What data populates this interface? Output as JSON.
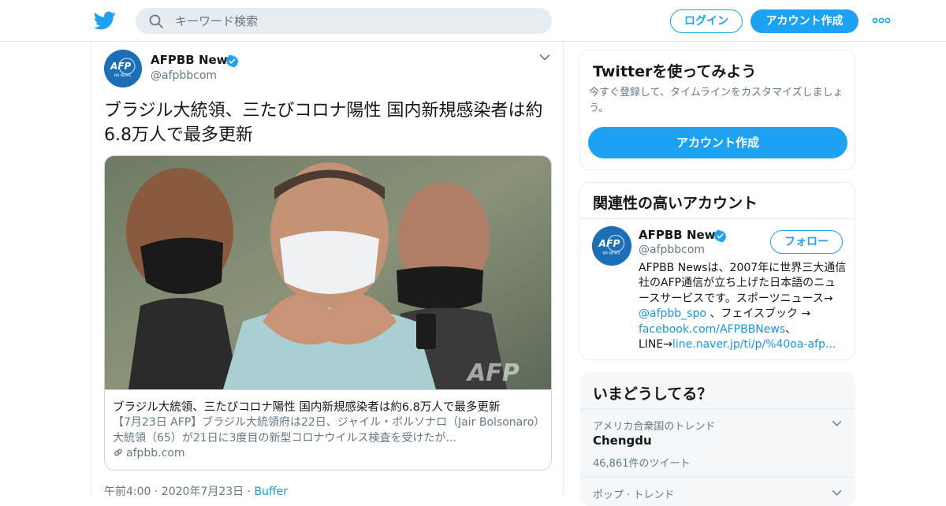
{
  "header": {
    "search_placeholder": "キーワード検索",
    "login_label": "ログイン",
    "signup_label": "アカウント作成"
  },
  "tweet": {
    "user_name": "AFPBB News",
    "user_handle": "@afpbbcom",
    "text": "ブラジル大統領、三たびコロナ陽性 国内新規感染者は約6.8万人で最多更新",
    "card": {
      "title": "ブラジル大統領、三たびコロナ陽性 国内新規感染者は約6.8万人で最多更新",
      "description": "【7月23日 AFP】ブラジル大統領府は22日、ジャイル・ボルソナロ（Jair Bolsonaro）大統領（65）が21日に3度目の新型コロナウイルス検査を受けたが...",
      "domain": "afpbb.com",
      "watermark": "AFP"
    },
    "time": "午前4:00",
    "date": "2020年7月23日",
    "source": "Buffer"
  },
  "signup_panel": {
    "heading": "Twitterを使ってみよう",
    "subtext": "今すぐ登録して、タイムラインをカスタマイズしましょう。",
    "button_label": "アカウント作成"
  },
  "related_panel": {
    "heading": "関連性の高いアカウント",
    "account": {
      "name": "AFPBB News",
      "handle": "@afpbbcom",
      "follow_label": "フォロー",
      "bio_text_1": "AFPBB Newsは、2007年に世界三大通信社のAFP通信が立ち上げた日本語のニュースサービスです。スポーツニュース→ ",
      "bio_link_1": "@afpbb_spo",
      "bio_text_2": " 、フェイスブック → ",
      "bio_link_2": "facebook.com/AFPBBNews",
      "bio_text_3": "、LINE→",
      "bio_link_3": "line.naver.jp/ti/p/%40oa-afp..."
    }
  },
  "trends_panel": {
    "heading": "いまどうしてる？",
    "trends": [
      {
        "context": "アメリカ合衆国のトレンド",
        "name": "Chengdu",
        "count": "46,861件のツイート"
      },
      {
        "context": "ポップ · トレンド",
        "name": "",
        "count": ""
      }
    ]
  },
  "colors": {
    "accent": "#1da1f2",
    "link": "#1b95e0",
    "secondary_text": "#657786",
    "border": "#e6ecf0"
  },
  "icons": [
    "twitter-bird-icon",
    "search-icon",
    "more-dots-icon",
    "verified-badge-icon",
    "chevron-down-icon",
    "link-icon",
    "afp-logo"
  ]
}
